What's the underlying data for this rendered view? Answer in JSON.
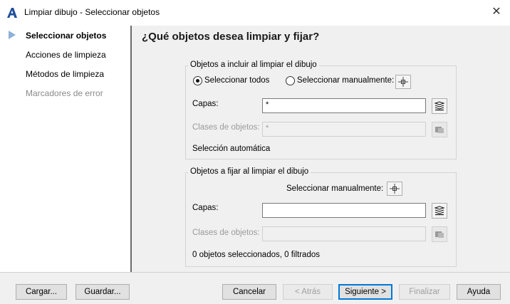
{
  "window": {
    "title": "Limpiar dibujo - Seleccionar objetos",
    "close_glyph": "✕"
  },
  "sidebar": {
    "items": [
      {
        "label": "Seleccionar objetos",
        "state": "active"
      },
      {
        "label": "Acciones de limpieza",
        "state": "normal"
      },
      {
        "label": "Métodos de limpieza",
        "state": "normal"
      },
      {
        "label": "Marcadores de error",
        "state": "disabled"
      }
    ]
  },
  "main": {
    "heading": "¿Qué objetos desea limpiar y fijar?",
    "include_group": {
      "title": "Objetos a incluir al limpiar el dibujo",
      "radio_all_label": "Seleccionar todos",
      "radio_all_checked": true,
      "radio_manual_label": "Seleccionar manualmente:",
      "radio_manual_checked": false,
      "layers_label": "Capas:",
      "layers_value": "*",
      "classes_label": "Clases de objetos:",
      "classes_value": "*",
      "status": "Selección automática"
    },
    "fix_group": {
      "title": "Objetos a fijar al limpiar el dibujo",
      "manual_label": "Seleccionar manualmente:",
      "layers_label": "Capas:",
      "layers_value": "",
      "classes_label": "Clases de objetos:",
      "classes_value": "",
      "status": "0 objetos seleccionados, 0 filtrados"
    }
  },
  "footer": {
    "load": "Cargar...",
    "save": "Guardar...",
    "cancel": "Cancelar",
    "back": "< Atrás",
    "next": "Siguiente >",
    "finish": "Finalizar",
    "help": "Ayuda"
  },
  "colors": {
    "accent": "#0078d7",
    "app_icon": "#1f4e9a",
    "nav_arrow": "#8fb0d8"
  }
}
